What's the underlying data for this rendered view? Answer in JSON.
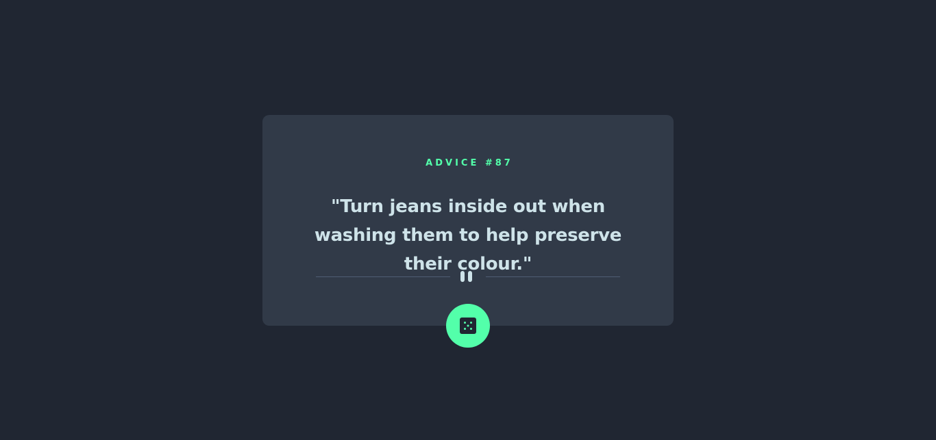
{
  "advice": {
    "id_label": "ADVICE #87",
    "text": "\"Turn jeans inside out when washing them to help preserve their colour.\""
  },
  "icons": {
    "divider": "pause-icon",
    "button": "dice-icon"
  },
  "colors": {
    "background": "#202632",
    "card": "#313a48",
    "accent": "#53ffaa",
    "text": "#cee3e9",
    "divider": "#4f5d74"
  }
}
